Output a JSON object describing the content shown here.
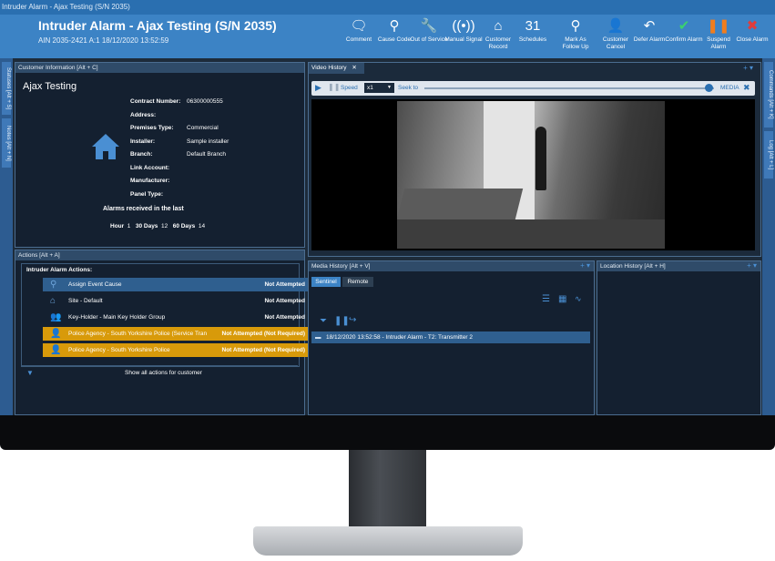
{
  "window_title": "Intruder Alarm - Ajax Testing (S/N 2035)",
  "header": {
    "title": "Intruder Alarm - Ajax Testing (S/N 2035)",
    "subtitle": "AIN 2035-2421   A:1   18/12/2020 13:52:59",
    "toolbar": [
      {
        "icon": "comment-icon",
        "glyph": "🗨",
        "label": "Comment",
        "color": "#ffffff"
      },
      {
        "icon": "search-icon",
        "glyph": "⚲",
        "label": "Cause Code",
        "color": "#ffffff"
      },
      {
        "icon": "wrench-icon",
        "glyph": "🔧",
        "label": "Out of Service",
        "color": "#ffffff"
      },
      {
        "icon": "signal-icon",
        "glyph": "((•))",
        "label": "Manual Signal",
        "color": "#ffffff"
      },
      {
        "icon": "home-icon",
        "glyph": "⌂",
        "label": "Customer Record",
        "color": "#ffffff"
      },
      {
        "icon": "calendar-icon",
        "glyph": "31",
        "label": "Schedules",
        "color": "#ffffff"
      },
      {
        "icon": "follow-up-icon",
        "glyph": "⚲",
        "label": "Mark As Follow Up",
        "color": "#ffffff"
      },
      {
        "icon": "user-cancel-icon",
        "glyph": "👤",
        "label": "Customer Cancel",
        "color": "#ffffff"
      },
      {
        "icon": "undo-icon",
        "glyph": "↶",
        "label": "Defer Alarm",
        "color": "#ffffff"
      },
      {
        "icon": "check-icon",
        "glyph": "✔",
        "label": "Confirm Alarm",
        "color": "#3bd16f"
      },
      {
        "icon": "pause-icon",
        "glyph": "❚❚",
        "label": "Suspend Alarm",
        "color": "#f07d1e"
      },
      {
        "icon": "close-icon",
        "glyph": "✖",
        "label": "Close Alarm",
        "color": "#e23b3b"
      }
    ]
  },
  "left_tabs": [
    "Statuses [Alt + S]",
    "Notes [Alt + N]"
  ],
  "right_tabs": [
    "Commands [Alt + K]",
    "Log [Alt + L]"
  ],
  "customer": {
    "panel_title": "Customer Information [Alt + C]",
    "name": "Ajax Testing",
    "fields": [
      {
        "label": "Contract Number:",
        "value": "06300000555"
      },
      {
        "label": "Address:",
        "value": ""
      },
      {
        "label": "Premises Type:",
        "value": "Commercial"
      },
      {
        "label": "Installer:",
        "value": "Sample installer"
      },
      {
        "label": "Branch:",
        "value": "Default Branch"
      },
      {
        "label": "Link Account:",
        "value": ""
      },
      {
        "label": "Manufacturer:",
        "value": ""
      },
      {
        "label": "Panel Type:",
        "value": ""
      }
    ],
    "alarms_heading": "Alarms received in the last",
    "alarms": {
      "hour_label": "Hour",
      "hour": "1",
      "d30_label": "30 Days",
      "d30": "12",
      "d60_label": "60 Days",
      "d60": "14"
    }
  },
  "actions": {
    "panel_title": "Actions [Alt + A]",
    "heading": "Intruder Alarm Actions:",
    "rows": [
      {
        "icon": "search-icon",
        "name": "Assign Event Cause",
        "status": "Not Attempted",
        "bg": "#2f5f8f"
      },
      {
        "icon": "home-icon",
        "name": "Site - Default",
        "status": "Not Attempted",
        "bg": "transparent"
      },
      {
        "icon": "users-icon",
        "name": "Key-Holder - Main Key Holder Group",
        "status": "Not Attempted",
        "bg": "transparent"
      },
      {
        "icon": "user-icon",
        "name": "Police Agency - South Yorkshire Police  (Service Tran",
        "status": "Not Attempted (Not Required)",
        "bg": "#d89a0a"
      },
      {
        "icon": "user-icon",
        "name": "Police Agency - South Yorkshire Police",
        "status": "Not Attempted (Not Required)",
        "bg": "#d89a0a"
      }
    ],
    "show_all": "Show all actions for customer"
  },
  "video": {
    "tab": "Video History",
    "speed_label": "Speed",
    "speed_value": "x1",
    "seek_label": "Seek to",
    "media_label": "MEDIA",
    "seek_position": 0.98
  },
  "media_history": {
    "panel_title": "Media History [Alt + V]",
    "tabs": [
      "Sentinel",
      "Remote"
    ],
    "entry": "18/12/2020 13:52:58 - Intruder Alarm - T2: Transmitter 2"
  },
  "location_history": {
    "panel_title": "Location History [Alt + H]"
  }
}
